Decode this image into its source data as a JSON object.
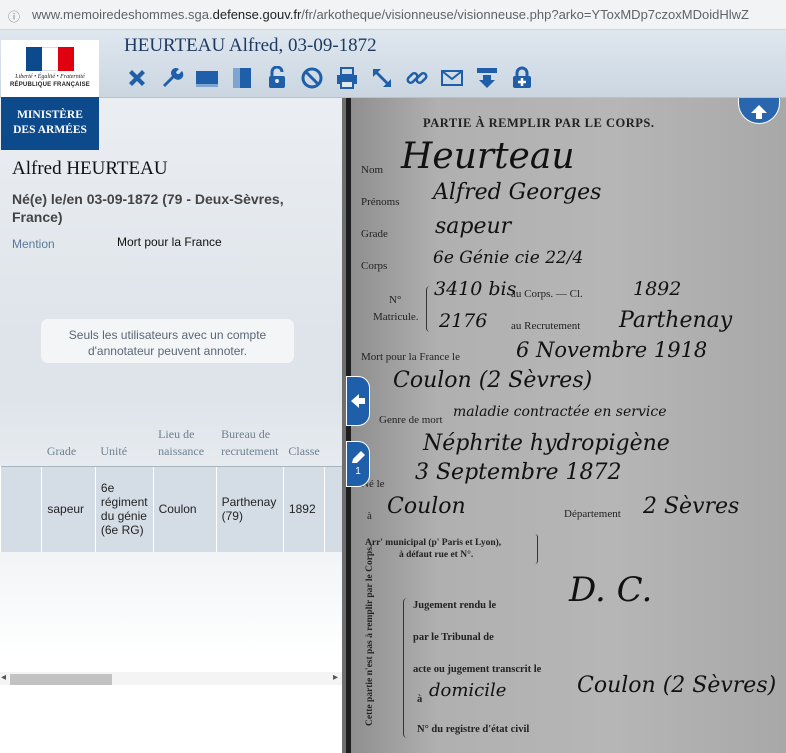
{
  "browser": {
    "url_prefix": "www.memoiredeshommes.sga.",
    "url_domain": "defense.gouv.fr",
    "url_path": "/fr/arkotheque/visionneuse/visionneuse.php?arko=YToxMDp7czoxMDoidHlwZ"
  },
  "logo": {
    "motto": "Liberté • Égalité • Fraternité",
    "republic": "RÉPUBLIQUE FRANÇAISE",
    "ministry_line1": "MINISTÈRE",
    "ministry_line2": "DES ARMÉES",
    "flag_colors": [
      "#0d4a8c",
      "#ffffff",
      "#e1000f"
    ]
  },
  "header": {
    "title": "HEURTEAU Alfred, 03-09-1872",
    "toolbar_icons": [
      "close-icon",
      "wrench-icon",
      "single-page-icon",
      "double-page-icon",
      "lock-icon",
      "forbidden-icon",
      "print-icon",
      "fullscreen-icon",
      "link-icon",
      "mail-icon",
      "download-icon",
      "lock-plus-icon"
    ]
  },
  "person": {
    "name": "Alfred HEURTEAU",
    "birth": "Né(e) le/en 03-09-1872 (79 - Deux-Sèvres, France)",
    "mention_label": "Mention",
    "mention_value": "Mort pour la France"
  },
  "notice": "Seuls les utilisateurs avec un compte d'annotateur peuvent annoter.",
  "table": {
    "headers": [
      "",
      "Grade",
      "Unité",
      "Lieu de naissance",
      "Bureau de recrutement",
      "Classe"
    ],
    "row": [
      "",
      "sapeur",
      "6e régiment du génie (6e RG)",
      "Coulon",
      "Parthenay (79)",
      "1892"
    ]
  },
  "viewer": {
    "annotate_count": "1",
    "printed": {
      "header": "PARTIE À REMPLIR PAR LE CORPS.",
      "nom": "Nom",
      "prenoms": "Prénoms",
      "grade": "Grade",
      "corps": "Corps",
      "no": "N°",
      "matricule": "Matricule.",
      "au_corps": "au Corps. — Cl.",
      "au_recrutement": "au Recrutement",
      "mort_pour": "Mort pour la France le",
      "genre_mort": "Genre de mort",
      "ne_le": "Né le",
      "a1": "à",
      "departement": "Département",
      "arr": "Arr' municipal (p' Paris et Lyon),",
      "arr2": "à défaut rue et N°.",
      "jugement": "Jugement rendu le",
      "tribunal": "par le Tribunal de",
      "acte": "acte ou jugement transcrit le",
      "a2": "à",
      "registre": "N° du registre d'état civil",
      "side": "Cette partie n'est pas à remplir par le Corps."
    },
    "handwritten": {
      "nom": "Heurteau",
      "prenoms": "Alfred Georges",
      "grade": "sapeur",
      "corps": "6e Génie cie 22/4",
      "no": "3410 bis",
      "classe": "1892",
      "matricule": "2176",
      "recrutement": "Parthenay",
      "mort_date": "6 Novembre 1918",
      "mort_lieu": "Coulon (2 Sèvres)",
      "genre": "maladie contractée en service",
      "cause": "Néphrite hydropigène",
      "naissance": "3 Septembre 1872",
      "lieu_naissance": "Coulon",
      "departement": "2 Sèvres",
      "initials": "D. C.",
      "domicile": "domicile",
      "transcription": "Coulon (2 Sèvres)"
    }
  }
}
